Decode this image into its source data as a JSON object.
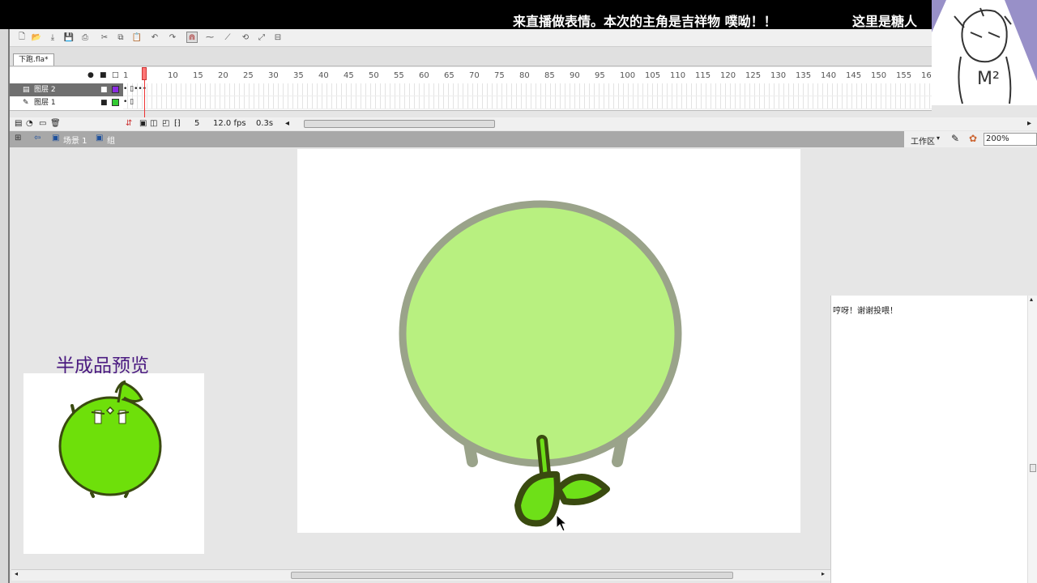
{
  "banner": {
    "text1": "来直播做表情。本次的主角是吉祥物 噗呦！！",
    "text2": "这里是糖人"
  },
  "toolbar": {
    "icons": [
      "new-icon",
      "open-icon",
      "import-icon",
      "save-icon",
      "print-icon",
      "cut-icon",
      "copy-icon",
      "paste-icon",
      "undo-icon",
      "redo-icon",
      "snap-icon",
      "smooth-icon",
      "straighten-icon",
      "rotate-icon",
      "scale-icon",
      "align-icon"
    ]
  },
  "document": {
    "tab_label": "下跑.fla*"
  },
  "timeline": {
    "ruler_ticks": [
      "1",
      "10",
      "15",
      "20",
      "25",
      "30",
      "35",
      "40",
      "45",
      "50",
      "55",
      "60",
      "65",
      "70",
      "75",
      "80",
      "85",
      "90",
      "95",
      "100",
      "105",
      "110",
      "115",
      "120",
      "125",
      "130",
      "135",
      "140",
      "145",
      "150",
      "155",
      "16"
    ],
    "layers": [
      {
        "name": "图层 2",
        "selected": true,
        "color": "#8a2be2"
      },
      {
        "name": "图层 1",
        "selected": false,
        "color": "#33cc33"
      }
    ],
    "current_frame": "5",
    "fps": "12.0 fps",
    "elapsed": "0.3s"
  },
  "editbar": {
    "scene_label": "场景 1",
    "group_label": "组",
    "workspace_label": "工作区",
    "zoom": "200%"
  },
  "preview": {
    "title": "半成品预览"
  },
  "chat": {
    "message": "哼呀！谢谢投喂！"
  },
  "colors": {
    "body_fill": "#b8f080",
    "body_outline": "#9aa38a",
    "sprout_fill": "#6ee018",
    "sprout_outline": "#3a4a10",
    "preview_fill": "#6ee00a"
  }
}
